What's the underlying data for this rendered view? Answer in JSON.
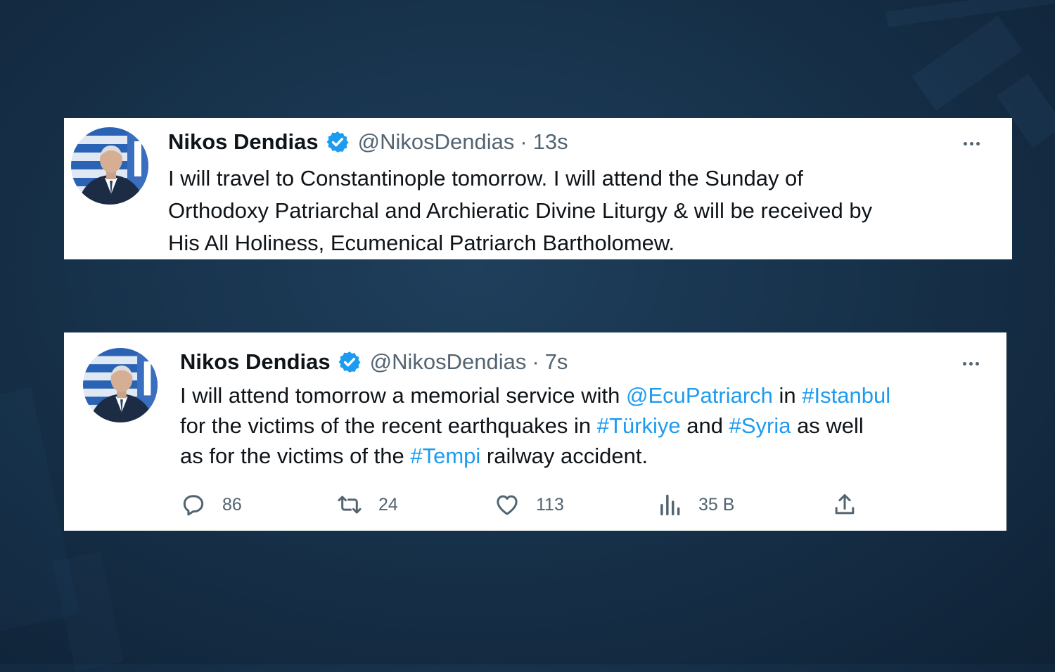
{
  "tweets": [
    {
      "author_name": "Nikos Dendias",
      "handle": "@NikosDendias",
      "separator": "·",
      "time": "13s",
      "lines": [
        "I will travel to Constantinople tomorrow.  I will attend the Sunday of",
        "Orthodoxy Patriarchal and Archieratic Divine Liturgy & will be received by",
        "His All Holiness, Ecumenical Patriarch Bartholomew."
      ]
    },
    {
      "author_name": "Nikos Dendias",
      "handle": "@NikosDendias",
      "separator": "·",
      "time": "7s",
      "line1": {
        "t1": "I will attend tomorrow a memorial service with ",
        "mention": "@EcuPatriarch",
        "t2": " in ",
        "tag": "#Istanbul"
      },
      "line2": {
        "t1": "for the victims of the recent earthquakes in ",
        "tag1": "#Türkiye",
        "t2": " and ",
        "tag2": "#Syria",
        "t3": " as well"
      },
      "line3": {
        "t1": "as for the victims of the ",
        "tag": "#Tempi",
        "t2": " railway accident."
      },
      "stats": {
        "replies": "86",
        "retweets": "24",
        "likes": "113",
        "views": "35 B"
      }
    }
  ],
  "icons": {
    "verified": "verified-badge-icon",
    "more": "more-options-icon",
    "reply": "reply-icon",
    "retweet": "retweet-icon",
    "like": "like-icon",
    "views": "views-icon",
    "share": "share-icon"
  },
  "colors": {
    "background": "#17324b",
    "card": "#ffffff",
    "text": "#0f1419",
    "secondary_text": "#536471",
    "link": "#1d9bf0",
    "verified": "#1d9bf0"
  }
}
